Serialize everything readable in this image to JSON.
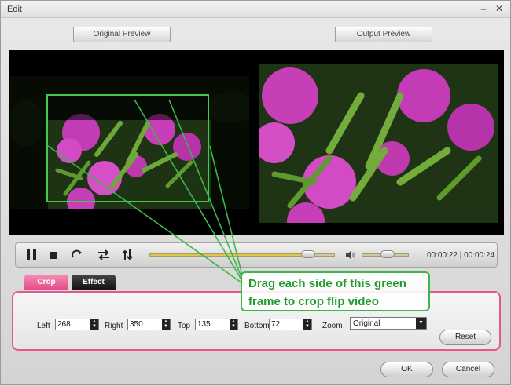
{
  "window": {
    "title": "Edit"
  },
  "preview": {
    "original_label": "Original Preview",
    "output_label": "Output Preview"
  },
  "player": {
    "time_text": "00:00:22 | 00:00:24",
    "progress": 0.86,
    "volume": 0.55
  },
  "tabs": [
    {
      "label": "Crop"
    },
    {
      "label": "Effect"
    }
  ],
  "crop": {
    "left": {
      "label": "Left",
      "value": "268"
    },
    "right": {
      "label": "Right",
      "value": "350"
    },
    "top": {
      "label": "Top",
      "value": "135"
    },
    "bottom": {
      "label": "Bottom",
      "value": "72"
    },
    "zoom": {
      "label": "Zoom",
      "value": "Original"
    }
  },
  "buttons": {
    "reset": "Reset",
    "ok": "OK",
    "cancel": "Cancel"
  },
  "annotation": {
    "line1": "Drag each side of this green",
    "line2": "frame to crop flip video"
  },
  "colors": {
    "accent_pink": "#e5588f",
    "annotation_green": "#3fb64a"
  }
}
